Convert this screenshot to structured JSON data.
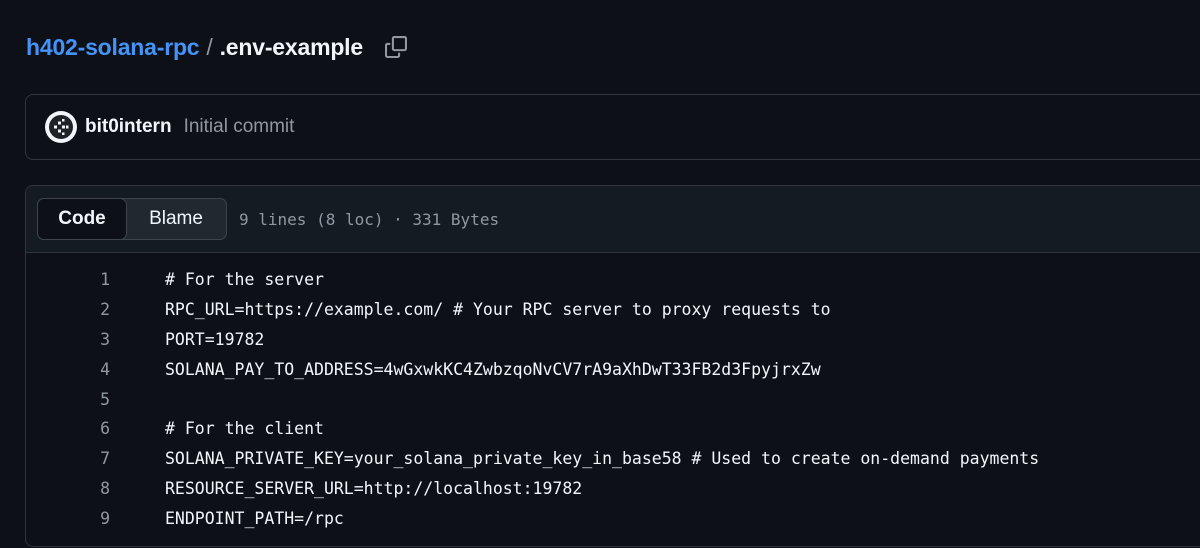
{
  "breadcrumb": {
    "repo": "h402-solana-rpc",
    "separator": "/",
    "file": ".env-example",
    "copy_icon": "copy-icon"
  },
  "commit": {
    "author": "bit0intern",
    "message": "Initial commit",
    "avatar_icon": "avatar-logo"
  },
  "code_view": {
    "tabs": [
      {
        "label": "Code",
        "selected": true
      },
      {
        "label": "Blame",
        "selected": false
      }
    ],
    "meta": "9 lines (8 loc) · 331 Bytes",
    "lines": [
      {
        "number": "1",
        "text": "# For the server"
      },
      {
        "number": "2",
        "text": "RPC_URL=https://example.com/ # Your RPC server to proxy requests to"
      },
      {
        "number": "3",
        "text": "PORT=19782"
      },
      {
        "number": "4",
        "text": "SOLANA_PAY_TO_ADDRESS=4wGxwkKC4ZwbzqoNvCV7rA9aXhDwT33FB2d3FpyjrxZw"
      },
      {
        "number": "5",
        "text": ""
      },
      {
        "number": "6",
        "text": "# For the client"
      },
      {
        "number": "7",
        "text": "SOLANA_PRIVATE_KEY=your_solana_private_key_in_base58 # Used to create on-demand payments"
      },
      {
        "number": "8",
        "text": "RESOURCE_SERVER_URL=http://localhost:19782"
      },
      {
        "number": "9",
        "text": "ENDPOINT_PATH=/rpc"
      }
    ]
  },
  "colors": {
    "background": "#0d1117",
    "link": "#4493f8",
    "muted": "#9198a1",
    "border": "#30363d"
  }
}
